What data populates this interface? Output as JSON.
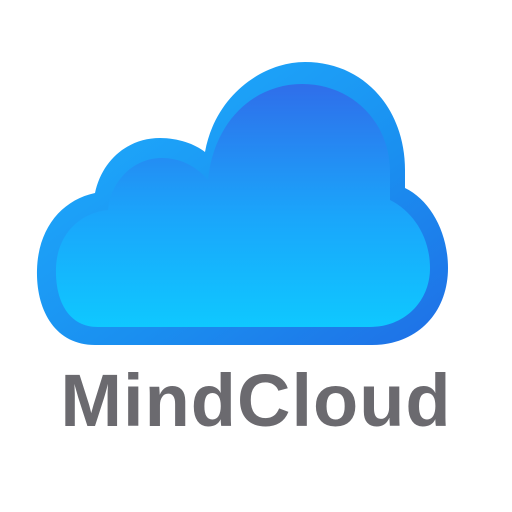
{
  "logo": {
    "icon": "cloud-icon",
    "brand_name": "MindCloud",
    "colors": {
      "cloud_outer": "#1a8ff0",
      "cloud_inner_top": "#2f74ec",
      "cloud_inner_bottom": "#12c6ff",
      "text": "#6b6a6f",
      "background": "#ffffff"
    }
  }
}
